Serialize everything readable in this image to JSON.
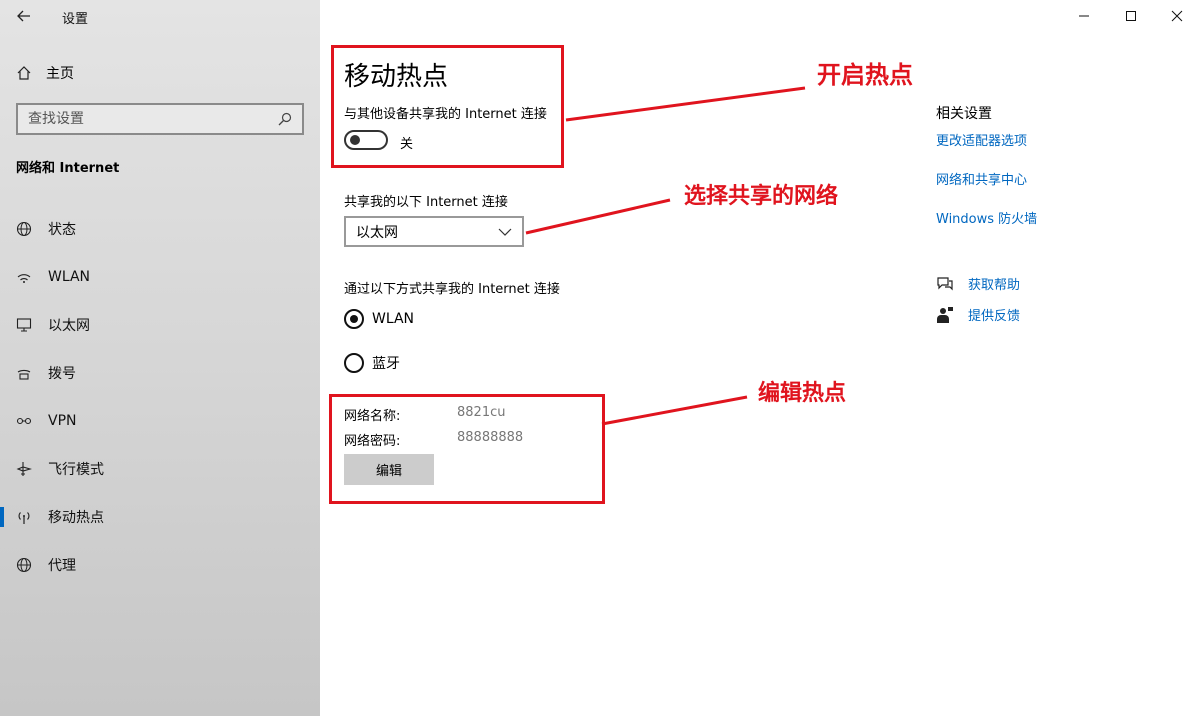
{
  "window": {
    "title": "设置"
  },
  "sidebar": {
    "home_label": "主页",
    "search_placeholder": "查找设置",
    "section_title": "网络和 Internet",
    "items": [
      {
        "label": "状态",
        "icon": "globe-status-icon"
      },
      {
        "label": "WLAN",
        "icon": "wifi-icon"
      },
      {
        "label": "以太网",
        "icon": "ethernet-icon"
      },
      {
        "label": "拨号",
        "icon": "dialup-icon"
      },
      {
        "label": "VPN",
        "icon": "vpn-icon"
      },
      {
        "label": "飞行模式",
        "icon": "airplane-icon"
      },
      {
        "label": "移动热点",
        "icon": "hotspot-icon",
        "active": true
      },
      {
        "label": "代理",
        "icon": "globe-icon"
      }
    ]
  },
  "main": {
    "title": "移动热点",
    "share_label": "与其他设备共享我的 Internet 连接",
    "toggle_state": "关",
    "share_from_label": "共享我的以下 Internet 连接",
    "share_from_value": "以太网",
    "share_via_label": "通过以下方式共享我的 Internet 连接",
    "share_via_options": [
      {
        "label": "WLAN",
        "selected": true
      },
      {
        "label": "蓝牙",
        "selected": false
      }
    ],
    "network_name_label": "网络名称:",
    "network_name_value": "8821cu",
    "network_password_label": "网络密码:",
    "network_password_value": "88888888",
    "edit_button": "编辑"
  },
  "annotations": {
    "enable": "开启热点",
    "choose": "选择共享的网络",
    "edit": "编辑热点",
    "color": "#e0141e"
  },
  "related": {
    "title": "相关设置",
    "links": [
      "更改适配器选项",
      "网络和共享中心",
      "Windows 防火墙"
    ],
    "help": "获取帮助",
    "feedback": "提供反馈"
  },
  "colors": {
    "accent": "#0067c0",
    "annotation": "#e0141e"
  }
}
